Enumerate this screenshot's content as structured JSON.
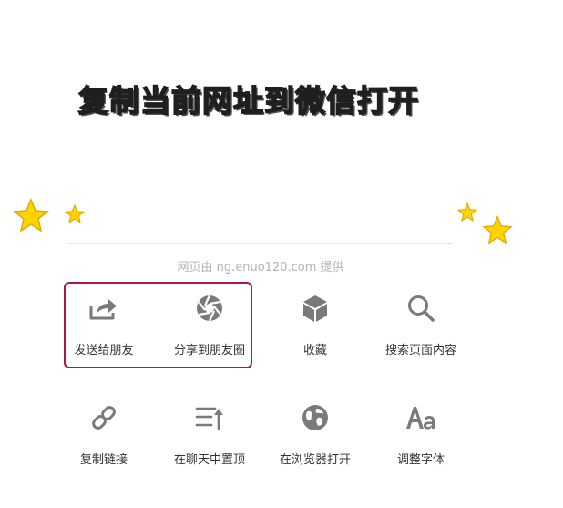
{
  "headline": "复制当前网址到微信打开",
  "provider_text": "网页由 ng.enuo120.com 提供",
  "colors": {
    "accent_border": "#a8174f",
    "icon": "#7a7a7a",
    "star": "#ffd400"
  },
  "actions_row1": [
    {
      "label": "发送给朋友",
      "icon": "share-arrow-icon"
    },
    {
      "label": "分享到朋友圈",
      "icon": "camera-aperture-icon"
    },
    {
      "label": "收藏",
      "icon": "cube-icon"
    },
    {
      "label": "搜索页面内容",
      "icon": "search-icon"
    }
  ],
  "actions_row2": [
    {
      "label": "复制链接",
      "icon": "link-icon"
    },
    {
      "label": "在聊天中置顶",
      "icon": "pin-top-icon"
    },
    {
      "label": "在浏览器打开",
      "icon": "globe-icon"
    },
    {
      "label": "调整字体",
      "icon": "font-size-icon"
    }
  ]
}
